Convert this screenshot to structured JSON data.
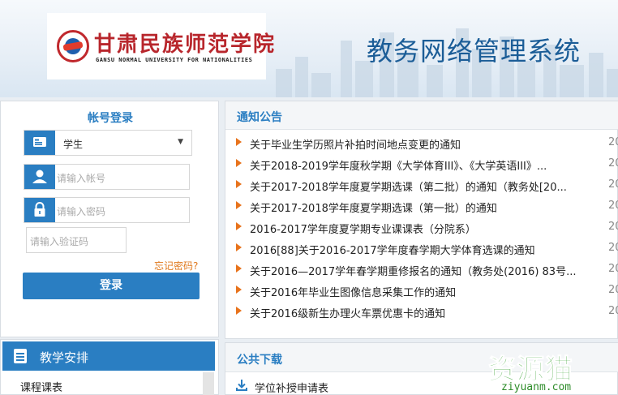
{
  "header": {
    "logo_cn": "甘肃民族师范学院",
    "logo_en": "GANSU NORMAL UNIVERSITY FOR NATIONALITIES",
    "system_title": "教务网络管理系统"
  },
  "login": {
    "title": "帐号登录",
    "role_selected": "学生",
    "account_placeholder": "请输入帐号",
    "password_placeholder": "请输入密码",
    "captcha_placeholder": "请输入验证码",
    "forgot_label": "忘记密码?",
    "login_button": "登录"
  },
  "teaching": {
    "title": "教学安排",
    "items": [
      "课程课表"
    ]
  },
  "notices": {
    "title": "通知公告",
    "items": [
      {
        "text": "关于毕业生学历照片补拍时间地点变更的通知",
        "date": "20"
      },
      {
        "text": "关于2018-2019学年度秋学期《大学体育III》、《大学英语III》...",
        "date": "20"
      },
      {
        "text": "关于2017-2018学年度夏学期选课（第二批）的通知（教务处[20...",
        "date": "20"
      },
      {
        "text": "关于2017-2018学年度夏学期选课（第一批）的通知",
        "date": "20"
      },
      {
        "text": "2016-2017学年度夏学期专业课课表（分院系）",
        "date": "20"
      },
      {
        "text": "2016[88]关于2016-2017学年度春学期大学体育选课的通知",
        "date": "20"
      },
      {
        "text": "关于2016—2017学年春学期重修报名的通知（教务处(2016) 83号...",
        "date": "20"
      },
      {
        "text": "关于2016年毕业生图像信息采集工作的通知",
        "date": "20"
      },
      {
        "text": "关于2016级新生办理火车票优惠卡的通知",
        "date": "20"
      }
    ]
  },
  "downloads": {
    "title": "公共下载",
    "items": [
      "学位补授申请表"
    ]
  },
  "watermark": {
    "cn": "资源猫",
    "en": "ziyuanm.com"
  },
  "colors": {
    "primary": "#2a7ec2",
    "accent_orange": "#e8731c",
    "logo_red": "#b8262c",
    "watermark_green": "#36a02f"
  },
  "icons": {
    "role": "id-card-icon",
    "account": "user-icon",
    "password": "lock-icon",
    "teaching": "document-list-icon",
    "notice_bullet": "triangle-right-icon",
    "download": "download-icon"
  }
}
